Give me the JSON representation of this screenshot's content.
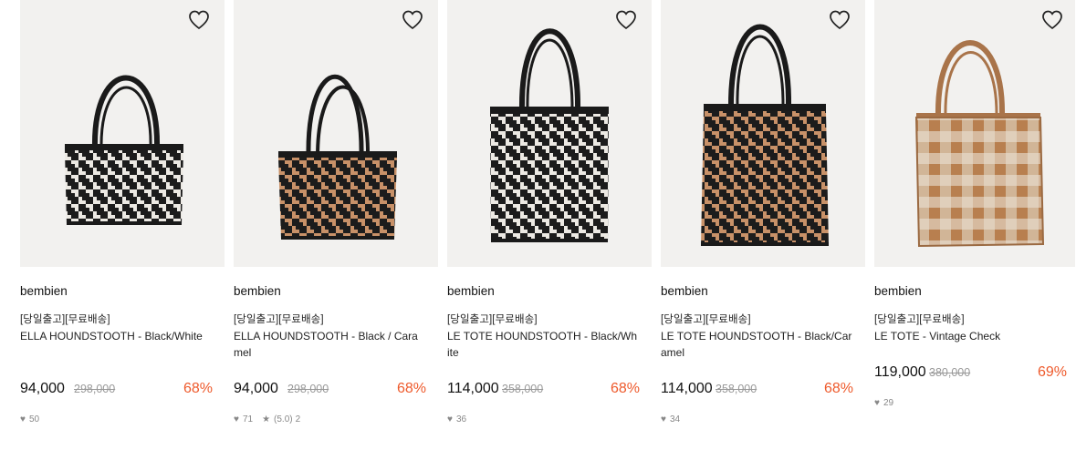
{
  "icons": {
    "wishlist": "heart-outline-icon",
    "likes": "heart-filled-icon",
    "rating": "star-filled-icon"
  },
  "colors": {
    "discount": "#ee5a2c",
    "image_bg": "#f2f1ef",
    "muted": "#888888"
  },
  "products": [
    {
      "brand": "bembien",
      "tag": "[당일출고][무료배송]",
      "name": "ELLA HOUNDSTOOTH - Black/White",
      "price": "94,000",
      "original_price": "298,000",
      "discount": "68%",
      "likes": "50",
      "rating": "",
      "reviews": ""
    },
    {
      "brand": "bembien",
      "tag": "[당일출고][무료배송]",
      "name": "ELLA HOUNDSTOOTH - Black / Caramel",
      "price": "94,000",
      "original_price": "298,000",
      "discount": "68%",
      "likes": "71",
      "rating": "(5.0)",
      "reviews": "2"
    },
    {
      "brand": "bembien",
      "tag": "[당일출고][무료배송]",
      "name": "LE TOTE HOUNDSTOOTH - Black/White",
      "price": "114,000",
      "original_price": "358,000",
      "discount": "68%",
      "likes": "36",
      "rating": "",
      "reviews": ""
    },
    {
      "brand": "bembien",
      "tag": "[당일출고][무료배송]",
      "name": "LE TOTE HOUNDSTOOTH - Black/Caramel",
      "price": "114,000",
      "original_price": "358,000",
      "discount": "68%",
      "likes": "34",
      "rating": "",
      "reviews": ""
    },
    {
      "brand": "bembien",
      "tag": "[당일출고][무료배송]",
      "name": "LE TOTE - Vintage Check",
      "price": "119,000",
      "original_price": "380,000",
      "discount": "69%",
      "likes": "29",
      "rating": "",
      "reviews": ""
    }
  ]
}
